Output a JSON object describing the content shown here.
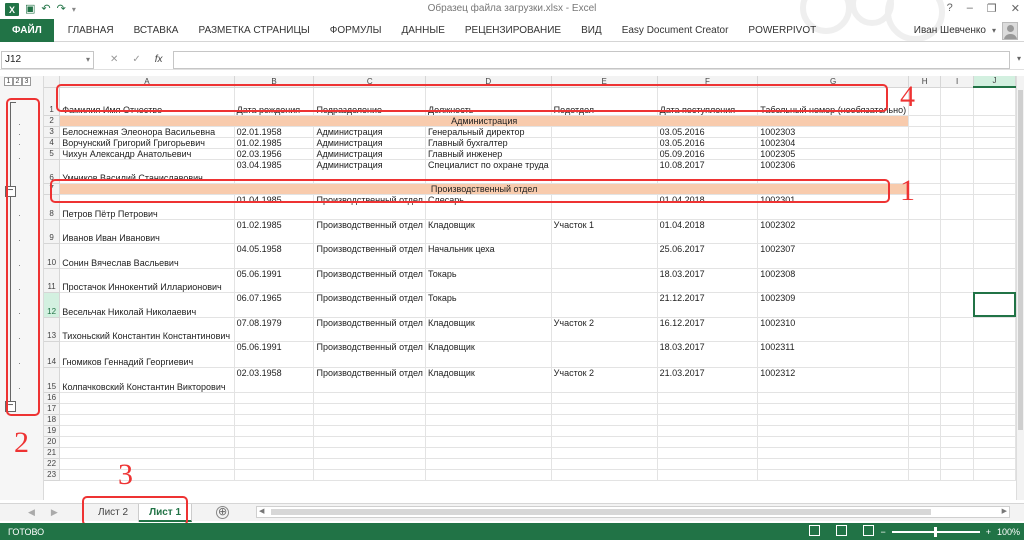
{
  "app": {
    "title": "Образец файла загрузки.xlsx - Excel",
    "help": "?",
    "minimize": "–",
    "restore": "❐",
    "close": "✕"
  },
  "ribbon": {
    "tabs": [
      "ФАЙЛ",
      "ГЛАВНАЯ",
      "ВСТАВКА",
      "РАЗМЕТКА СТРАНИЦЫ",
      "ФОРМУЛЫ",
      "ДАННЫЕ",
      "РЕЦЕНЗИРОВАНИЕ",
      "ВИД",
      "Easy Document Creator",
      "POWERPIVOT"
    ],
    "user": "Иван Шевченко"
  },
  "formula_bar": {
    "name_box": "J12",
    "fx": "fx",
    "value": ""
  },
  "grid": {
    "outline_levels": [
      "1",
      "2",
      "3"
    ],
    "columns": [
      "A",
      "B",
      "C",
      "D",
      "E",
      "F",
      "G",
      "H",
      "I",
      "J"
    ],
    "rows": [
      {
        "n": "1",
        "cells": [
          "Фамилия Имя Отчество",
          "Дата рождения",
          "Подразделение",
          "Должность",
          "Подотдел",
          "Дата поступления",
          "Табельный номер (необязательно)"
        ]
      },
      {
        "n": "2",
        "band": "Администрация"
      },
      {
        "n": "3",
        "cells": [
          "Белоснежная Элеонора Васильевна",
          "02.01.1958",
          "Администрация",
          "Генеральный директор",
          "",
          "03.05.2016",
          "1002303"
        ]
      },
      {
        "n": "4",
        "cells": [
          "Ворчунский Григорий Григорьевич",
          "01.02.1985",
          "Администрация",
          "Главный бухгалтер",
          "",
          "03.05.2016",
          "1002304"
        ]
      },
      {
        "n": "5",
        "cells": [
          "Чихун Александр Анатольевич",
          "02.03.1956",
          "Администрация",
          "Главный инженер",
          "",
          "05.09.2016",
          "1002305"
        ]
      },
      {
        "n": "6",
        "cells": [
          "Умников Василий Станиславович",
          "03.04.1985",
          "Администрация",
          "Специалист по охране труда",
          "",
          "10.08.2017",
          "1002306"
        ]
      },
      {
        "n": "7",
        "band": "Производственный отдел"
      },
      {
        "n": "8",
        "cells": [
          "Петров Пётр Петрович",
          "01.04.1985",
          "Производственный отдел",
          "Слесарь",
          "",
          "01.04.2018",
          "1002301"
        ]
      },
      {
        "n": "9",
        "cells": [
          "Иванов Иван Иванович",
          "01.02.1985",
          "Производственный отдел",
          "Кладовщик",
          "Участок 1",
          "01.04.2018",
          "1002302"
        ]
      },
      {
        "n": "10",
        "cells": [
          "Сонин Вячеслав Васльевич",
          "04.05.1958",
          "Производственный отдел",
          "Начальник цеха",
          "",
          "25.06.2017",
          "1002307"
        ]
      },
      {
        "n": "11",
        "cells": [
          "Простачок Иннокентий Илларионович",
          "05.06.1991",
          "Производственный отдел",
          "Токарь",
          "",
          "18.03.2017",
          "1002308"
        ]
      },
      {
        "n": "12",
        "cells": [
          "Весельчак Николай Николаевич",
          "06.07.1965",
          "Производственный отдел",
          "Токарь",
          "",
          "21.12.2017",
          "1002309"
        ]
      },
      {
        "n": "13",
        "cells": [
          "Тихоньский Константин Константинович",
          "07.08.1979",
          "Производственный отдел",
          "Кладовщик",
          "Участок 2",
          "16.12.2017",
          "1002310"
        ]
      },
      {
        "n": "14",
        "cells": [
          "Гномиков Геннадий Георгиевич",
          "05.06.1991",
          "Производственный отдел",
          "Кладовщик",
          "",
          "18.03.2017",
          "1002311"
        ]
      },
      {
        "n": "15",
        "cells": [
          "Колпачковский Константин Викторович",
          "02.03.1958",
          "Производственный отдел",
          "Кладовщик",
          "Участок 2",
          "21.03.2017",
          "1002312"
        ]
      },
      {
        "n": "16"
      },
      {
        "n": "17"
      },
      {
        "n": "18"
      },
      {
        "n": "19"
      },
      {
        "n": "20"
      },
      {
        "n": "21"
      },
      {
        "n": "22"
      },
      {
        "n": "23"
      }
    ]
  },
  "callouts": [
    "1",
    "2",
    "3",
    "4"
  ],
  "sheets": {
    "tabs": [
      "Лист 2",
      "Лист 1"
    ],
    "active": "Лист 1",
    "add": "⊕"
  },
  "status": {
    "text": "ГОТОВО",
    "zoom": "100%"
  },
  "colors": {
    "excel_green": "#217346",
    "band_fill": "#f8cbad",
    "callout_red": "#e33333"
  }
}
